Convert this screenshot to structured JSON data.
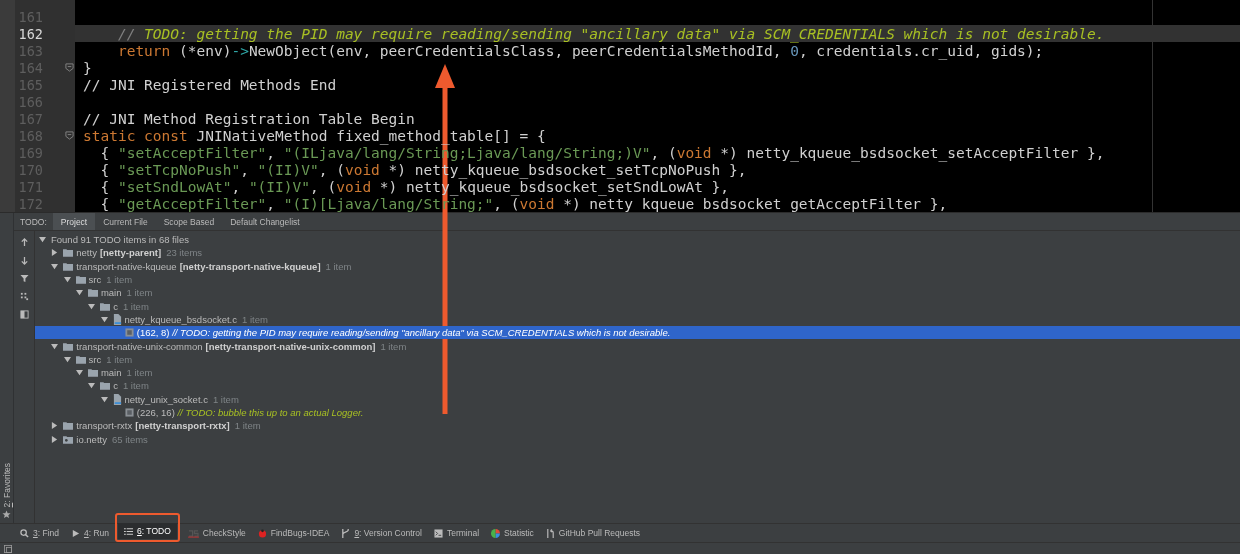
{
  "editor": {
    "lines": [
      {
        "number": "161",
        "current": false,
        "fold": false
      },
      {
        "number": "162",
        "current": true,
        "fold": false,
        "tokens": [
          {
            "kind": "cmt",
            "text": "    // "
          },
          {
            "kind": "todo",
            "text": "TODO: getting the PID may require reading/sending \"ancillary data\" via SCM_CREDENTIALS which is not desirable."
          }
        ]
      },
      {
        "number": "163",
        "current": false,
        "fold": false,
        "tokens": [
          {
            "kind": "kw",
            "text": "    return"
          },
          {
            "kind": "plain",
            "text": " (*env)"
          },
          {
            "kind": "op",
            "text": "->"
          },
          {
            "kind": "plain",
            "text": "NewObject(env, peerCredentialsClass, peerCredentialsMethodId, "
          },
          {
            "kind": "num",
            "text": "0"
          },
          {
            "kind": "plain",
            "text": ", credentials.cr_uid, gids);"
          }
        ]
      },
      {
        "number": "164",
        "current": false,
        "fold": true,
        "tokens": [
          {
            "kind": "plain",
            "text": "}"
          }
        ]
      },
      {
        "number": "165",
        "current": false,
        "fold": false,
        "tokens": [
          {
            "kind": "plain",
            "text": "// JNI Registered Methods End"
          }
        ]
      },
      {
        "number": "166",
        "current": false,
        "fold": false
      },
      {
        "number": "167",
        "current": false,
        "fold": false,
        "tokens": [
          {
            "kind": "plain",
            "text": "// JNI Method Registration Table Begin"
          }
        ]
      },
      {
        "number": "168",
        "current": false,
        "fold": true,
        "tokens": [
          {
            "kind": "kw",
            "text": "static const"
          },
          {
            "kind": "plain",
            "text": " JNINativeMethod fixed_method_table[] = {"
          }
        ]
      },
      {
        "number": "169",
        "current": false,
        "fold": false,
        "tokens": [
          {
            "kind": "plain",
            "text": "  { "
          },
          {
            "kind": "str",
            "text": "\"setAcceptFilter\""
          },
          {
            "kind": "plain",
            "text": ", "
          },
          {
            "kind": "str",
            "text": "\"(ILjava/lang/String;Ljava/lang/String;)V\""
          },
          {
            "kind": "plain",
            "text": ", ("
          },
          {
            "kind": "kw",
            "text": "void"
          },
          {
            "kind": "plain",
            "text": " *) netty_kqueue_bsdsocket_setAcceptFilter },"
          }
        ]
      },
      {
        "number": "170",
        "current": false,
        "fold": false,
        "tokens": [
          {
            "kind": "plain",
            "text": "  { "
          },
          {
            "kind": "str",
            "text": "\"setTcpNoPush\""
          },
          {
            "kind": "plain",
            "text": ", "
          },
          {
            "kind": "str",
            "text": "\"(II)V\""
          },
          {
            "kind": "plain",
            "text": ", ("
          },
          {
            "kind": "kw",
            "text": "void"
          },
          {
            "kind": "plain",
            "text": " *) netty_kqueue_bsdsocket_setTcpNoPush },"
          }
        ]
      },
      {
        "number": "171",
        "current": false,
        "fold": false,
        "tokens": [
          {
            "kind": "plain",
            "text": "  { "
          },
          {
            "kind": "str",
            "text": "\"setSndLowAt\""
          },
          {
            "kind": "plain",
            "text": ", "
          },
          {
            "kind": "str",
            "text": "\"(II)V\""
          },
          {
            "kind": "plain",
            "text": ", ("
          },
          {
            "kind": "kw",
            "text": "void"
          },
          {
            "kind": "plain",
            "text": " *) netty_kqueue_bsdsocket_setSndLowAt },"
          }
        ]
      },
      {
        "number": "172",
        "current": false,
        "fold": false,
        "tokens": [
          {
            "kind": "plain",
            "text": "  { "
          },
          {
            "kind": "str",
            "text": "\"getAcceptFilter\""
          },
          {
            "kind": "plain",
            "text": ", "
          },
          {
            "kind": "str",
            "text": "\"(I)[Ljava/lang/String;\""
          },
          {
            "kind": "plain",
            "text": ", ("
          },
          {
            "kind": "kw",
            "text": "void"
          },
          {
            "kind": "plain",
            "text": " *) netty_kqueue_bsdsocket_getAcceptFilter },"
          }
        ]
      }
    ]
  },
  "todo_panel": {
    "label": "TODO:",
    "tabs": [
      {
        "label": "Project",
        "selected": true
      },
      {
        "label": "Current File",
        "selected": false
      },
      {
        "label": "Scope Based",
        "selected": false
      },
      {
        "label": "Default Changelist",
        "selected": false
      }
    ],
    "tree": {
      "summary": "Found 91 TODO items in 68 files",
      "expanded": true,
      "children": [
        {
          "kind": "module",
          "name": "netty",
          "module": "[netty-parent]",
          "count": "23 items",
          "expanded": false
        },
        {
          "kind": "module",
          "name": "transport-native-kqueue",
          "module": "[netty-transport-native-kqueue]",
          "count": "1 item",
          "expanded": true,
          "children": [
            {
              "kind": "folder",
              "name": "src",
              "count": "1 item",
              "expanded": true,
              "children": [
                {
                  "kind": "folder",
                  "name": "main",
                  "count": "1 item",
                  "expanded": true,
                  "children": [
                    {
                      "kind": "folder",
                      "name": "c",
                      "count": "1 item",
                      "expanded": true,
                      "children": [
                        {
                          "kind": "file",
                          "name": "netty_kqueue_bsdsocket.c",
                          "count": "1 item",
                          "expanded": true,
                          "children": [
                            {
                              "kind": "todo",
                              "position": "(162, 8)",
                              "text": "// TODO: getting the PID may require reading/sending \"ancillary data\" via SCM_CREDENTIALS which is not desirable.",
                              "selected": true
                            }
                          ]
                        }
                      ]
                    }
                  ]
                }
              ]
            }
          ]
        },
        {
          "kind": "module",
          "name": "transport-native-unix-common",
          "module": "[netty-transport-native-unix-common]",
          "count": "1 item",
          "expanded": true,
          "children": [
            {
              "kind": "folder",
              "name": "src",
              "count": "1 item",
              "expanded": true,
              "children": [
                {
                  "kind": "folder",
                  "name": "main",
                  "count": "1 item",
                  "expanded": true,
                  "children": [
                    {
                      "kind": "folder",
                      "name": "c",
                      "count": "1 item",
                      "expanded": true,
                      "children": [
                        {
                          "kind": "file",
                          "name": "netty_unix_socket.c",
                          "count": "1 item",
                          "expanded": true,
                          "children": [
                            {
                              "kind": "todo",
                              "position": "(226, 16)",
                              "text": "// TODO: bubble this up to an actual Logger.",
                              "selected": false
                            }
                          ]
                        }
                      ]
                    }
                  ]
                }
              ]
            }
          ]
        },
        {
          "kind": "module",
          "name": "transport-rxtx",
          "module": "[netty-transport-rxtx]",
          "count": "1 item",
          "expanded": false
        },
        {
          "kind": "package",
          "name": "io.netty",
          "count": "65 items",
          "expanded": false
        }
      ]
    }
  },
  "favorites": {
    "key": "2",
    "label": ": Favorites"
  },
  "tool_bar": [
    {
      "key": "3",
      "label": ": Find",
      "selected": false,
      "highlighted": false
    },
    {
      "key": "4",
      "label": ": Run",
      "selected": false,
      "highlighted": false
    },
    {
      "key": "6",
      "label": ": TODO",
      "selected": true,
      "highlighted": true
    },
    {
      "label": "CheckStyle",
      "selected": false,
      "highlighted": false
    },
    {
      "label": "FindBugs-IDEA",
      "selected": false,
      "highlighted": false
    },
    {
      "key": "9",
      "label": ": Version Control",
      "selected": false,
      "highlighted": false
    },
    {
      "label": "Terminal",
      "selected": false,
      "highlighted": false
    },
    {
      "label": "Statistic",
      "selected": false,
      "highlighted": false
    },
    {
      "label": "GitHub Pull Requests",
      "selected": false,
      "highlighted": false
    }
  ]
}
